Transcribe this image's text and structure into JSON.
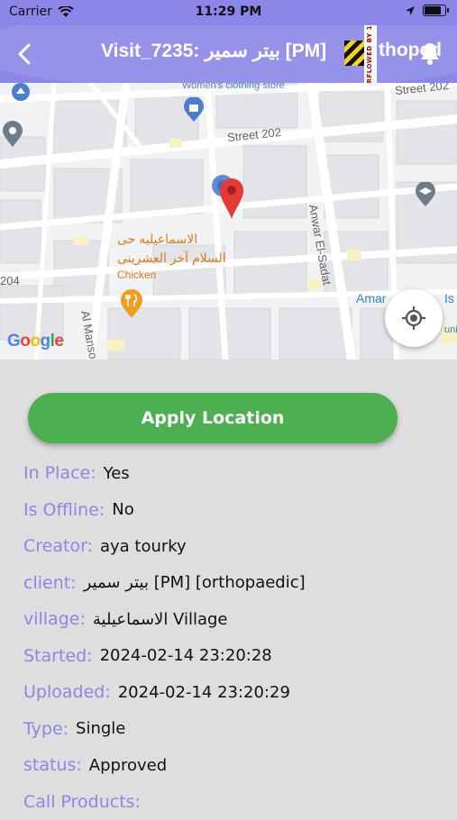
{
  "status_bar": {
    "carrier": "Carrier",
    "time": "11:29 PM",
    "battery_level": 0.9
  },
  "nav": {
    "title": "Visit_7235: بيتر سمير [PM] ",
    "title_tail": "thoped",
    "ribbon_text": "RFLOWED BY 1"
  },
  "map": {
    "labels": {
      "street_202": "Street 202",
      "street_202b": "Street 202",
      "womens_store": "Women's clothing store",
      "anwar": "Anwar El-Sadat",
      "al_manso": "Al Manso",
      "num_204": "204",
      "ismailia_1": "الاسماعيليه حى",
      "ismailia_2": "السلام آخر العشرينى",
      "chicken": "Chicken",
      "amar": "Amar",
      "is": "Is",
      "tail": "unic"
    },
    "google_letters": [
      "G",
      "o",
      "o",
      "g",
      "l",
      "e"
    ],
    "google_colors": [
      "#4285F4",
      "#EA4335",
      "#FBBC05",
      "#4285F4",
      "#34A853",
      "#EA4335"
    ]
  },
  "apply_button": {
    "label": "Apply Location"
  },
  "details": {
    "in_place": {
      "label": "In Place:",
      "value": "Yes"
    },
    "is_offline": {
      "label": "Is Offline:",
      "value": "No"
    },
    "creator": {
      "label": "Creator:",
      "value": "aya tourky"
    },
    "client": {
      "label": "client:",
      "value": "بيتر سمير [PM] [orthopaedic]"
    },
    "village": {
      "label": "village:",
      "value": "الاسماعيلية Village"
    },
    "started": {
      "label": "Started:",
      "value": "2024-02-14 23:20:28"
    },
    "uploaded": {
      "label": "Uploaded:",
      "value": "2024-02-14 23:20:29"
    },
    "type": {
      "label": "Type:",
      "value": "Single"
    },
    "status": {
      "label": "status:",
      "value": "Approved"
    },
    "call_products": {
      "label": "Call Products:",
      "value": ""
    }
  },
  "colors": {
    "accent": "#8b86e8",
    "apply_green": "#4caf50",
    "pin_red": "#e53935"
  }
}
